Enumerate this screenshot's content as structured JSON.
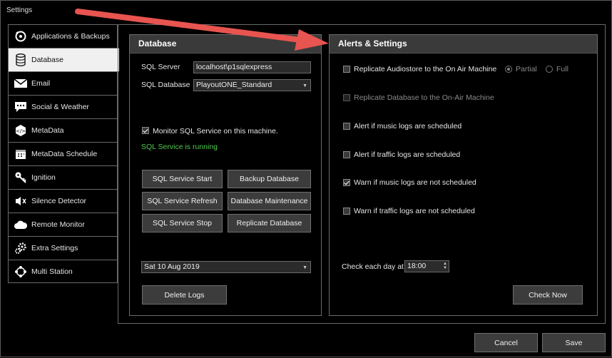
{
  "window": {
    "title": "Settings"
  },
  "nav": {
    "items": [
      {
        "label": "Applications & Backups",
        "icon": "applications-backups-icon"
      },
      {
        "label": "Database",
        "icon": "database-icon"
      },
      {
        "label": "Email",
        "icon": "email-icon"
      },
      {
        "label": "Social & Weather",
        "icon": "social-weather-icon"
      },
      {
        "label": "MetaData",
        "icon": "metadata-icon"
      },
      {
        "label": "MetaData Schedule",
        "icon": "metadata-schedule-icon"
      },
      {
        "label": "Ignition",
        "icon": "ignition-key-icon"
      },
      {
        "label": "Silence Detector",
        "icon": "speaker-mute-icon"
      },
      {
        "label": "Remote Monitor",
        "icon": "cloud-icon"
      },
      {
        "label": "Extra Settings",
        "icon": "gears-icon"
      },
      {
        "label": "Multi Station",
        "icon": "multi-station-icon"
      }
    ],
    "active": "Database"
  },
  "database": {
    "title": "Database",
    "sql_server_label": "SQL Server",
    "sql_server_value": "localhost\\p1sqlexpress",
    "sql_database_label": "SQL Database",
    "sql_database_value": "PlayoutONE_Standard",
    "monitor_label": "Monitor SQL Service on this machine.",
    "monitor_checked": true,
    "status": "SQL Service is running",
    "buttons": {
      "start": "SQL Service Start",
      "backup": "Backup Database",
      "refresh": "SQL Service Refresh",
      "maintenance": "Database Maintenance",
      "stop": "SQL Service Stop",
      "replicate": "Replicate Database"
    },
    "date_value": "Sat 10 Aug 2019",
    "delete_logs": "Delete Logs"
  },
  "alerts": {
    "title": "Alerts & Settings",
    "replicate_audiostore": "Replicate Audiostore to the On Air Machine",
    "partial": "Partial",
    "full": "Full",
    "replicate_database": "Replicate Database to the On-Air Machine",
    "alert_music": "Alert if music logs are scheduled",
    "alert_traffic": "Alert if traffic logs are scheduled",
    "warn_music": "Warn if music logs are not scheduled",
    "warn_traffic": "Warn if traffic logs are not scheduled",
    "check_each_day": "Check each day at",
    "check_time": "18:00",
    "check_now": "Check Now"
  },
  "footer": {
    "cancel": "Cancel",
    "save": "Save"
  },
  "colors": {
    "status_green": "#4ec94e",
    "arrow_red": "#e8544f",
    "panel_header": "#3a3a3a"
  }
}
